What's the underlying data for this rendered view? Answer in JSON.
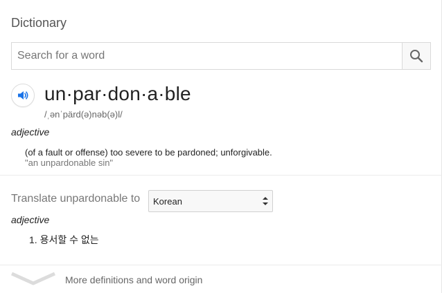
{
  "header": {
    "title": "Dictionary"
  },
  "search": {
    "placeholder": "Search for a word",
    "value": "",
    "button_icon": "search-icon"
  },
  "entry": {
    "speaker_icon": "speaker-icon",
    "word": "un·par·don·a·ble",
    "phonetic": "/ˌənˈpärd(ə)nəb(ə)l/",
    "part_of_speech": "adjective",
    "definition": "(of a fault or offense) too severe to be pardoned; unforgivable.",
    "example": "\"an unpardonable sin\""
  },
  "translate": {
    "label": "Translate unpardonable to",
    "language": "Korean",
    "part_of_speech": "adjective",
    "items": [
      {
        "text": "1. 용서할 수 없는"
      }
    ]
  },
  "footer": {
    "more_label": "More definitions and word origin",
    "chevron_icon": "chevron-down-icon"
  },
  "colors": {
    "speaker_blue": "#1a73e8",
    "text_primary": "#222222",
    "text_secondary": "#777777",
    "border": "#d9d9d9"
  }
}
